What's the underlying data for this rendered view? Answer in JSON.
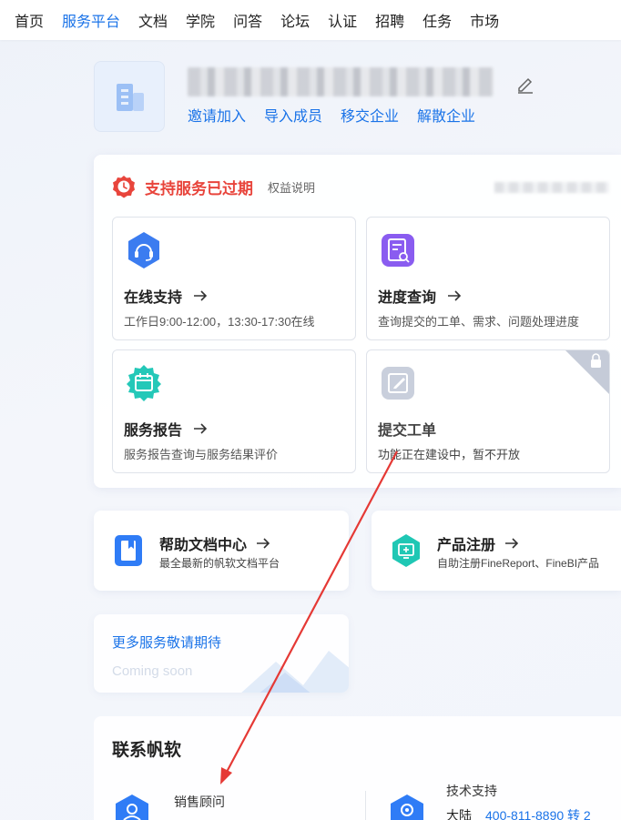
{
  "nav": {
    "items": [
      "首页",
      "服务平台",
      "文档",
      "学院",
      "问答",
      "论坛",
      "认证",
      "招聘",
      "任务",
      "市场"
    ],
    "active_index": 1
  },
  "enterprise": {
    "actions": [
      "邀请加入",
      "导入成员",
      "移交企业",
      "解散企业"
    ]
  },
  "support": {
    "status_title": "支持服务已过期",
    "rights_link": "权益说明",
    "cards": [
      {
        "title": "在线支持",
        "desc": "工作日9:00-12:00，13:30-17:30在线",
        "icon": "headset-icon"
      },
      {
        "title": "进度查询",
        "desc": "查询提交的工单、需求、问题处理进度",
        "icon": "document-search-icon"
      },
      {
        "title": "服务报告",
        "desc": "服务报告查询与服务结果评价",
        "icon": "calendar-icon"
      },
      {
        "title": "提交工单",
        "desc": "功能正在建设中，暂不开放",
        "icon": "edit-form-icon",
        "locked": true
      }
    ]
  },
  "help_doc": {
    "title": "帮助文档中心",
    "desc": "最全最新的帆软文档平台"
  },
  "product_reg": {
    "title": "产品注册",
    "desc": "自助注册FineReport、FineBI产品"
  },
  "coming_soon": {
    "title": "更多服务敬请期待",
    "subtitle": "Coming soon"
  },
  "contact": {
    "title": "联系帆软",
    "sales_label": "销售顾问",
    "tech_label": "技术支持",
    "tech_region": "大陆",
    "tech_phone": "400-811-8890 转 2"
  },
  "colors": {
    "accent": "#1a73e8",
    "expired": "#e8453c",
    "annotation": "#e53935"
  }
}
